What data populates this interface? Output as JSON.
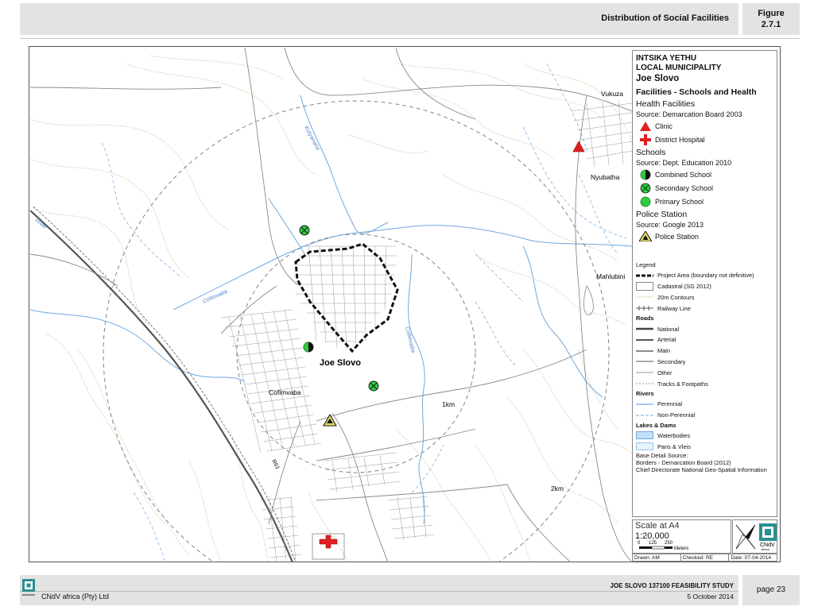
{
  "header": {
    "title": "Distribution of Social Facilities",
    "figure_label": "Figure",
    "figure_number": "2.7.1"
  },
  "map": {
    "town_label": "Joe Slovo",
    "place_labels": [
      "Vukuza",
      "Nyubatha",
      "Mahlubini",
      "Cofimvaba"
    ],
    "river_labels": [
      "Kutyanana",
      "Cofimvaba",
      "Cofimvaba",
      "River"
    ],
    "road_label": "R61",
    "ring_labels": [
      "1km",
      "2km"
    ]
  },
  "legend": {
    "title_line1": "INTSIKA YETHU",
    "title_line2": "LOCAL MUNICIPALITY",
    "place": "Joe Slovo",
    "subtitle": "Facilities - Schools and Health",
    "health": {
      "heading": "Health Facilities",
      "source": "Source: Demarcation Board 2003",
      "items": [
        "Clinic",
        "District Hospital"
      ]
    },
    "schools": {
      "heading": "Schools",
      "source": "Source: Dept. Education 2010",
      "items": [
        "Combined School",
        "Secondary School",
        "Primary School"
      ]
    },
    "police": {
      "heading": "Police Station",
      "source": "Source: Google 2013",
      "items": [
        "Police Station"
      ]
    },
    "general": {
      "heading": "Legend",
      "project_area": "Project Area (boundary not definitive)",
      "cadastral": "Cadastral (SG 2012)",
      "contours": "20m Contours",
      "railway": "Railway Line"
    },
    "roads": {
      "heading": "Roads",
      "items": [
        "National",
        "Arterial",
        "Main",
        "Secondary",
        "Other",
        "Tracks & Footpaths"
      ]
    },
    "rivers": {
      "heading": "Rivers",
      "items": [
        "Perennial",
        "Non-Perennial"
      ]
    },
    "lakes": {
      "heading": "Lakes & Dams",
      "items": [
        "Waterbodies",
        "Pans & Vleis"
      ]
    },
    "base": {
      "line1": "Base Detail Source:",
      "line2": "Borders - Demarcation Board (2012)",
      "line3": "Chief Directorate National Geo-Spatial Information"
    }
  },
  "scale": {
    "label": "Scale at A4",
    "ratio": "1:20,000",
    "tick_0": "0",
    "tick_125": "125",
    "tick_250": "250",
    "unit": "Meters"
  },
  "logo_text": "CNdV",
  "logo_subtext": "africa",
  "info": {
    "drawn": "Drawn: AM",
    "checked": "Checked: RE",
    "date": "Date: 07-04-2014"
  },
  "footer": {
    "company": "CNdV africa (Pty) Ltd",
    "study": "JOE SLOVO 137100 FEASIBILITY STUDY",
    "date": "5 October 2014",
    "page": "page 23"
  },
  "colors": {
    "river": "#6fa8dc",
    "contour": "#c8b98a",
    "clinic": "#e02020",
    "school_green": "#2ecc40",
    "police_yellow": "#e8e06a"
  }
}
